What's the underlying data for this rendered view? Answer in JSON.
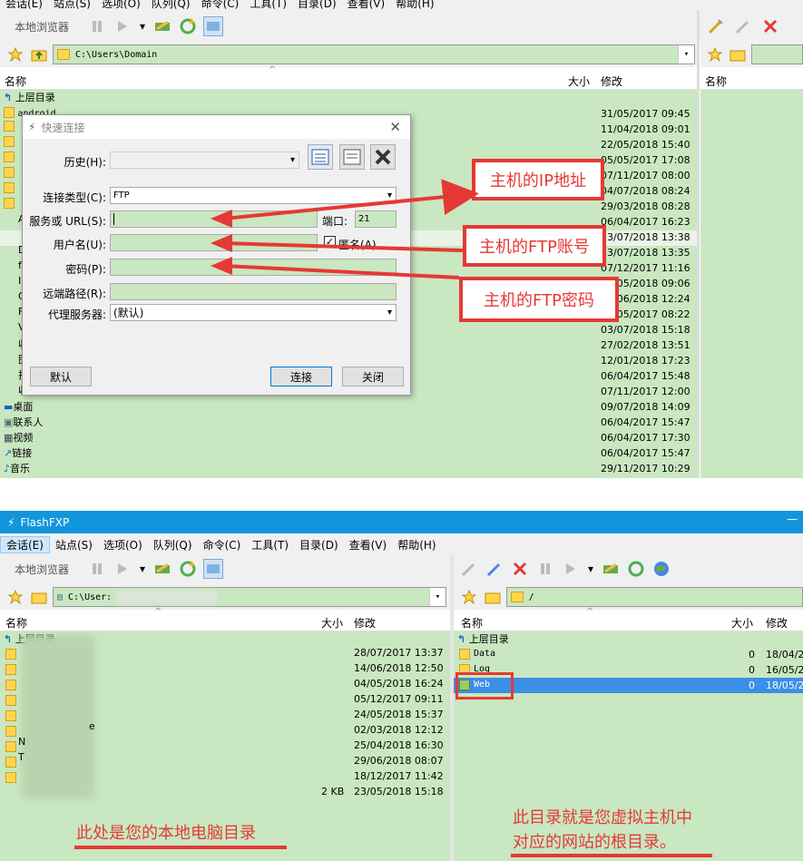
{
  "top": {
    "menu": [
      "会话(E)",
      "站点(S)",
      "选项(O)",
      "队列(Q)",
      "命令(C)",
      "工具(T)",
      "目录(D)",
      "查看(V)",
      "帮助(H)"
    ],
    "local_label": "本地浏览器",
    "path": "C:\\Users\\Domain",
    "col_name": "名称",
    "col_size": "大小",
    "col_modified": "修改",
    "parent_dir": "上层目录",
    "first_item": "android",
    "dates": [
      "31/05/2017 09:45",
      "11/04/2018 09:01",
      "22/05/2018 15:40",
      "05/05/2017 17:08",
      "07/11/2017 08:00",
      "04/07/2018 08:24",
      "29/03/2018 08:28",
      "06/04/2017 16:23",
      "13/07/2018 13:38",
      "13/07/2018 13:35",
      "07/12/2017 11:16",
      "24/05/2018 09:06",
      "05/06/2018 12:24",
      "04/05/2017 08:22",
      "03/07/2018 15:18",
      "27/02/2018 13:51",
      "12/01/2018 17:23",
      "06/04/2017 15:48",
      "07/11/2017 12:00",
      "09/07/2018 14:09",
      "06/04/2017 15:47",
      "06/04/2017 17:30",
      "06/04/2017 15:47",
      "29/11/2017 10:29"
    ],
    "bottom_items": [
      "桌面",
      "联系人",
      "视频",
      "链接",
      "音乐"
    ],
    "partial_letters": [
      "A",
      "D",
      "D",
      "f",
      "I",
      "O",
      "F",
      "V",
      "收",
      "图",
      "扫",
      "收"
    ]
  },
  "dialog": {
    "title": "快速连接",
    "history_label": "历史(H):",
    "conn_type_label": "连接类型(C):",
    "conn_type_value": "FTP",
    "server_label": "服务或 URL(S):",
    "port_label": "端口:",
    "port_value": "21",
    "user_label": "用户名(U):",
    "anon_label": "匿名(A)",
    "pass_label": "密码(P):",
    "remote_label": "远端路径(R):",
    "proxy_label": "代理服务器:",
    "proxy_value": "(默认)",
    "default_btn": "默认",
    "connect_btn": "连接",
    "close_btn": "关闭"
  },
  "callouts": {
    "ip": "主机的IP地址",
    "ftp_user": "主机的FTP账号",
    "ftp_pass": "主机的FTP密码"
  },
  "bottom": {
    "app_title": "FlashFXP",
    "menu": [
      "会话(E)",
      "站点(S)",
      "选项(O)",
      "队列(Q)",
      "命令(C)",
      "工具(T)",
      "目录(D)",
      "查看(V)",
      "帮助(H)"
    ],
    "local_label": "本地浏览器",
    "local_path": "C:\\User:",
    "remote_path": "/",
    "col_name": "名称",
    "col_size": "大小",
    "col_modified": "修改",
    "parent_dir": "上层目录",
    "local_dates": [
      "28/07/2017 13:37",
      "14/06/2018 12:50",
      "04/05/2018 16:24",
      "05/12/2017 09:11",
      "24/05/2018 15:37",
      "02/03/2018 12:12",
      "25/04/2018 16:30",
      "29/06/2018 08:07",
      "18/12/2017 11:42",
      "23/05/2018 15:18"
    ],
    "local_last_size": "2 KB",
    "local_partial": [
      "N",
      "T",
      "e"
    ],
    "remote_items": [
      {
        "name": "Data",
        "size": "0",
        "date": "18/04/2"
      },
      {
        "name": "Log",
        "size": "0",
        "date": "16/05/2"
      },
      {
        "name": "Web",
        "size": "0",
        "date": "18/05/2"
      }
    ],
    "note_local": "此处是您的本地电脑目录",
    "note_remote_1": "此目录就是您虚拟主机中",
    "note_remote_2": "对应的网站的根目录。"
  },
  "colors": {
    "pane_bg": "#c9e7c0",
    "accent_red": "#e53935",
    "selected_row": "#3d8ee6",
    "titlebar": "#1296db"
  }
}
